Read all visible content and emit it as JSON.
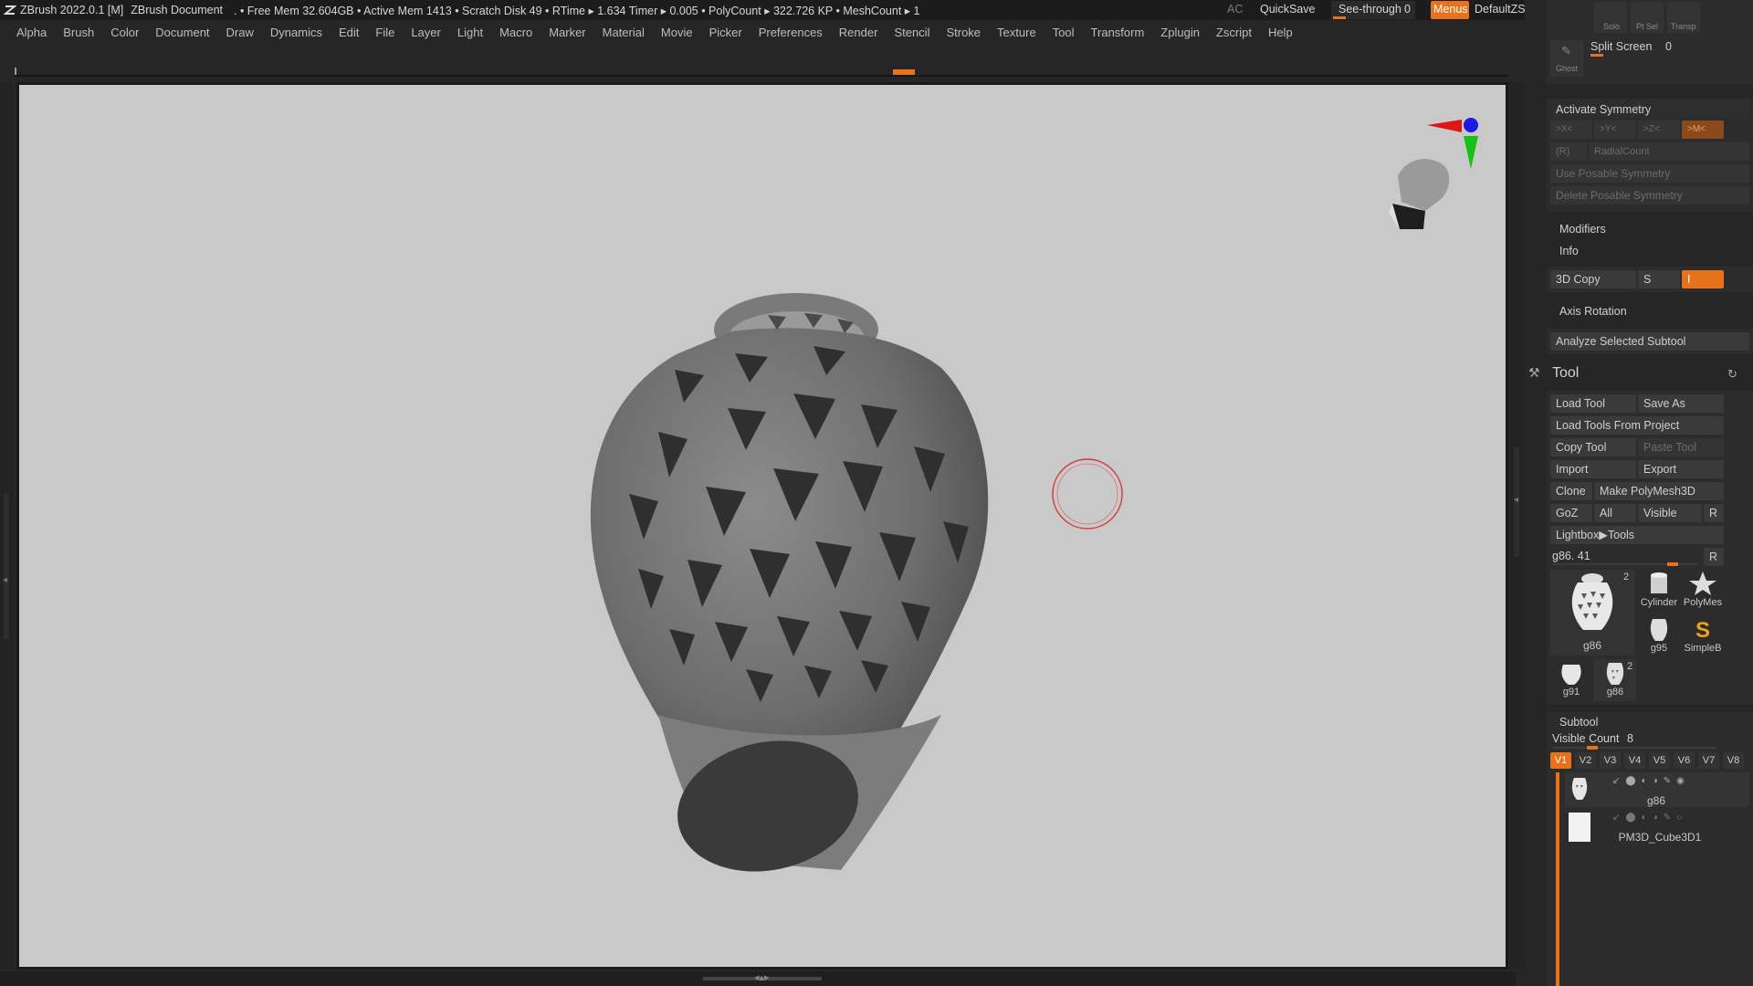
{
  "titlebar": {
    "app_title": "ZBrush 2022.0.1 [M]",
    "document": "ZBrush Document",
    "stats": ". • Free Mem 32.604GB • Active Mem 1413 • Scratch Disk 49 •  RTime ▸ 1.634 Timer ▸ 0.005 • PolyCount ▸ 322.726 KP  • MeshCount ▸ 1",
    "ac": "AC",
    "quicksave": "QuickSave",
    "see_through_label": "See-through",
    "see_through_value": "0",
    "menus_label": "Menus",
    "default_zscript": "DefaultZScript"
  },
  "menubar": {
    "items": [
      "Alpha",
      "Brush",
      "Color",
      "Document",
      "Draw",
      "Dynamics",
      "Edit",
      "File",
      "Layer",
      "Light",
      "Macro",
      "Marker",
      "Material",
      "Movie",
      "Picker",
      "Preferences",
      "Render",
      "Stencil",
      "Stroke",
      "Texture",
      "Tool",
      "Transform",
      "Zplugin",
      "Zscript",
      "Help"
    ]
  },
  "right_panel": {
    "top_icons": {
      "solo": "Solo",
      "ptsel": "Pt Sel",
      "transp": "Transp",
      "ghost": "Ghost"
    },
    "split_screen_label": "Split Screen",
    "split_screen_value": "0",
    "symmetry": {
      "activate": "Activate Symmetry",
      "x": ">X<",
      "y": ">Y<",
      "z": ">Z<",
      "m": ">M<",
      "r": "(R)",
      "radial_count": "RadialCount",
      "use_posable": "Use Posable Symmetry",
      "delete_posable": "Delete Posable Symmetry"
    },
    "modifiers": "Modifiers",
    "info": "Info",
    "copy3d": "3D Copy",
    "copy3d_s": "S",
    "copy3d_i": "I",
    "axis_rotation": "Axis Rotation",
    "analyze": "Analyze Selected Subtool",
    "tool": {
      "header": "Tool",
      "load_tool": "Load Tool",
      "save_as": "Save As",
      "load_from_project": "Load Tools From Project",
      "copy_tool": "Copy Tool",
      "paste_tool": "Paste Tool",
      "import": "Import",
      "export": "Export",
      "clone": "Clone",
      "make_polymesh": "Make PolyMesh3D",
      "goz": "GoZ",
      "all": "All",
      "visible": "Visible",
      "r": "R",
      "lightbox_tools": "Lightbox▶Tools",
      "current_tool": "g86. 41",
      "current_r": "R",
      "thumbs": [
        {
          "name": "g86",
          "badge": "2"
        },
        {
          "name": "Cylinder",
          "badge": ""
        },
        {
          "name": "PolyMes",
          "badge": ""
        },
        {
          "name": "g95",
          "badge": ""
        },
        {
          "name": "SimpleB",
          "badge": ""
        },
        {
          "name": "g91",
          "badge": ""
        },
        {
          "name": "g86",
          "badge": "2"
        }
      ]
    },
    "subtool": {
      "header": "Subtool",
      "visible_count_label": "Visible Count",
      "visible_count_value": "8",
      "tabs": [
        "V1",
        "V2",
        "V3",
        "V4",
        "V5",
        "V6",
        "V7",
        "V8"
      ],
      "active_tab": "V1",
      "items": [
        {
          "name": "g86"
        },
        {
          "name": "PM3D_Cube3D1"
        }
      ]
    }
  },
  "colors": {
    "accent": "#e8711c",
    "viewport_bg": "#c9c9c9",
    "panel_bg": "#2c2c2c"
  },
  "icons": [
    "zbrush-logo-icon",
    "tool-wrench-icon",
    "refresh-icon",
    "gizmo-icon",
    "brush-cursor-icon",
    "vase-thumbnail-icon",
    "cube-thumbnail-icon"
  ]
}
